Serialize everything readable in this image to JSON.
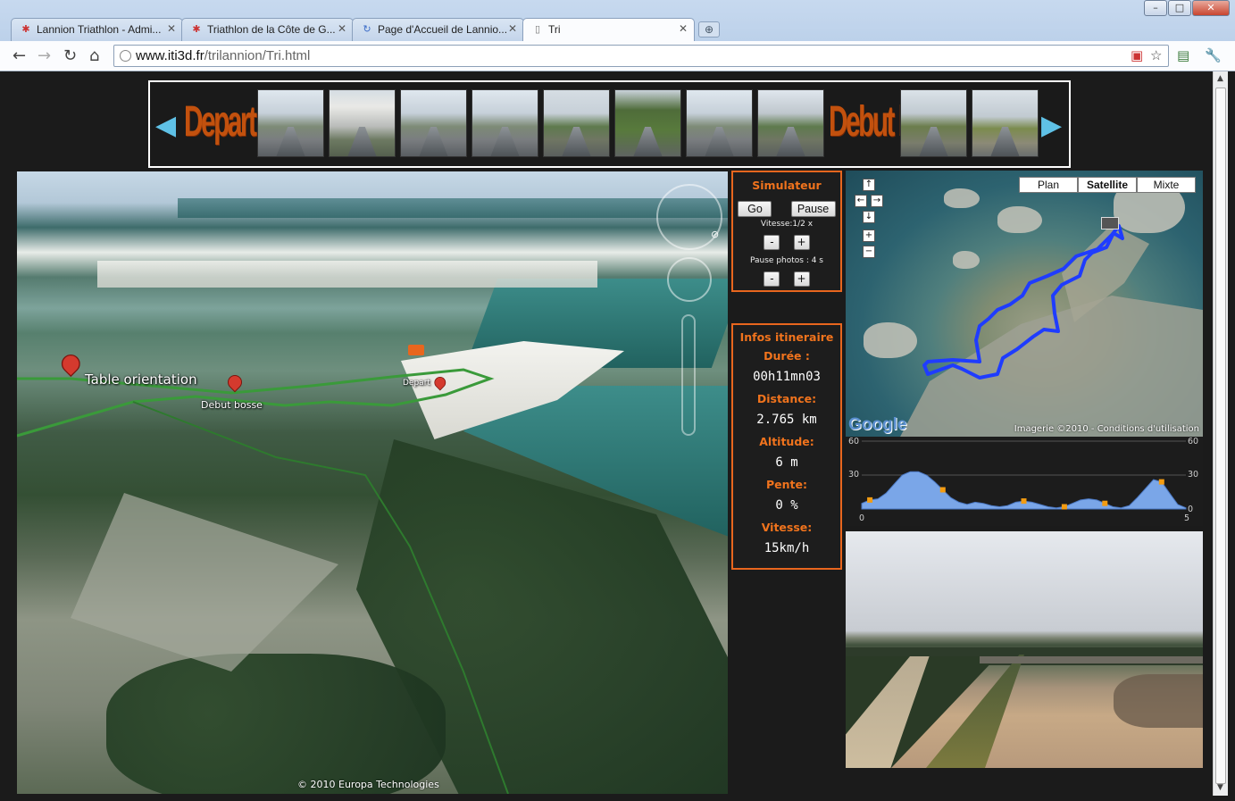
{
  "browser": {
    "tabs": [
      {
        "label": "Lannion Triathlon - Admi...",
        "icon": "joomla-icon"
      },
      {
        "label": "Triathlon de la Côte de G...",
        "icon": "joomla-icon"
      },
      {
        "label": "Page d'Accueil de Lannio...",
        "icon": "loading-icon"
      },
      {
        "label": "Tri",
        "icon": "page-icon"
      }
    ],
    "url_domain": "www.iti3d.fr",
    "url_path": "/trilannion/Tri.html"
  },
  "strip": {
    "start_label": "Depart",
    "mid_label": "Debut bosse"
  },
  "earth": {
    "markers": [
      {
        "label": "Table orientation"
      },
      {
        "label": "Debut bosse"
      },
      {
        "label": "Depart"
      }
    ],
    "copyright": "© 2010 Europa Technologies"
  },
  "simulator": {
    "title": "Simulateur",
    "go": "Go",
    "pause": "Pause",
    "speed_label": "Vitesse:1/2 x",
    "minus": "-",
    "plus": "+",
    "photo_pause_label": "Pause photos : 4 s"
  },
  "infos": {
    "title": "Infos itineraire",
    "duration_label": "Durée :",
    "duration": "00h11mn03",
    "distance_label": "Distance:",
    "distance": "2.765 km",
    "altitude_label": "Altitude:",
    "altitude": "6 m",
    "slope_label": "Pente:",
    "slope": "0 %",
    "speed_label": "Vitesse:",
    "speed": "15km/h"
  },
  "map": {
    "types": [
      "Plan",
      "Satellite",
      "Mixte"
    ],
    "active_type": "Satellite",
    "logo": "Google",
    "copyright": "Imagerie ©2010 - Conditions d'utilisation",
    "route_color": "#1f3cff"
  },
  "elevation": {
    "y_top": "60",
    "y_mid": "30",
    "y_bottom": "0",
    "x_start": "0",
    "x_end": "5",
    "profile": [
      5,
      8,
      9,
      14,
      22,
      30,
      33,
      33,
      30,
      24,
      17,
      10,
      6,
      4,
      6,
      5,
      3,
      2,
      3,
      6,
      7,
      6,
      4,
      2,
      1,
      2,
      5,
      8,
      9,
      8,
      5,
      2,
      1,
      3,
      10,
      18,
      26,
      24,
      14,
      4,
      1
    ],
    "fill_color": "#7aa6e8",
    "marker_color": "#f39c12"
  }
}
